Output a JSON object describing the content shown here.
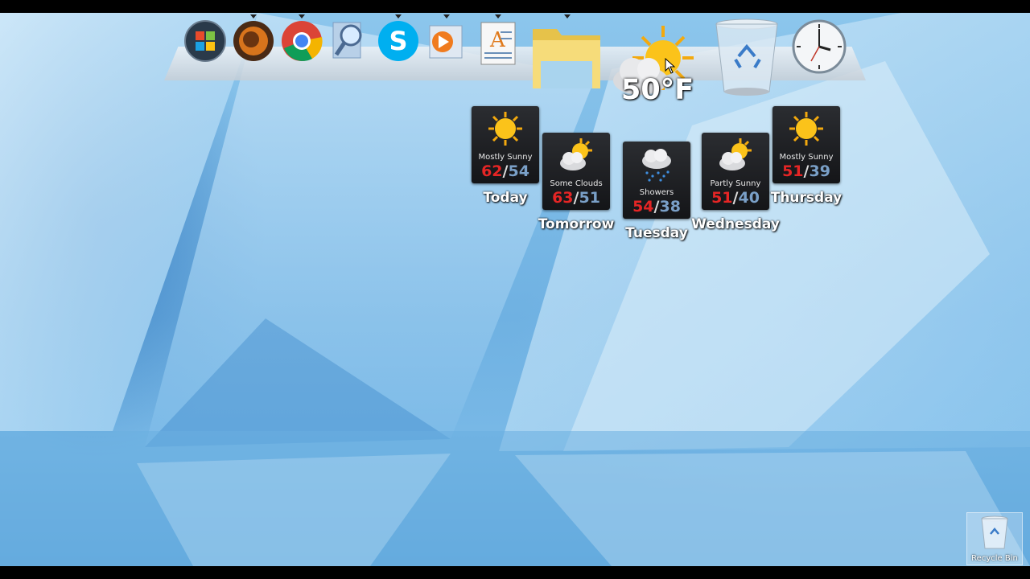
{
  "dock": {
    "items": [
      {
        "name": "start-orb-icon"
      },
      {
        "name": "firefox-icon"
      },
      {
        "name": "chrome-icon"
      },
      {
        "name": "search-icon"
      },
      {
        "name": "skype-icon"
      },
      {
        "name": "media-player-icon"
      },
      {
        "name": "wordpad-icon"
      },
      {
        "name": "folder-icon"
      },
      {
        "name": "recycle-bin-icon"
      },
      {
        "name": "clock-icon"
      }
    ],
    "current_temp": "50°F"
  },
  "forecast": [
    {
      "day": "Today",
      "condition": "Mostly Sunny",
      "high": "62",
      "low": "54",
      "icon": "sun-icon"
    },
    {
      "day": "Tomorrow",
      "condition": "Some Clouds",
      "high": "63",
      "low": "51",
      "icon": "partly-cloudy-icon"
    },
    {
      "day": "Tuesday",
      "condition": "Showers",
      "high": "54",
      "low": "38",
      "icon": "rain-icon"
    },
    {
      "day": "Wednesday",
      "condition": "Partly Sunny",
      "high": "51",
      "low": "40",
      "icon": "partly-cloudy-icon"
    },
    {
      "day": "Thursday",
      "condition": "Mostly Sunny",
      "high": "51",
      "low": "39",
      "icon": "sun-icon"
    }
  ],
  "desktop": {
    "recycle_bin_label": "Recycle Bin"
  },
  "colors": {
    "high_temp": "#e52525",
    "low_temp": "#7aa0c8",
    "card_bg": "#1e1f22"
  }
}
